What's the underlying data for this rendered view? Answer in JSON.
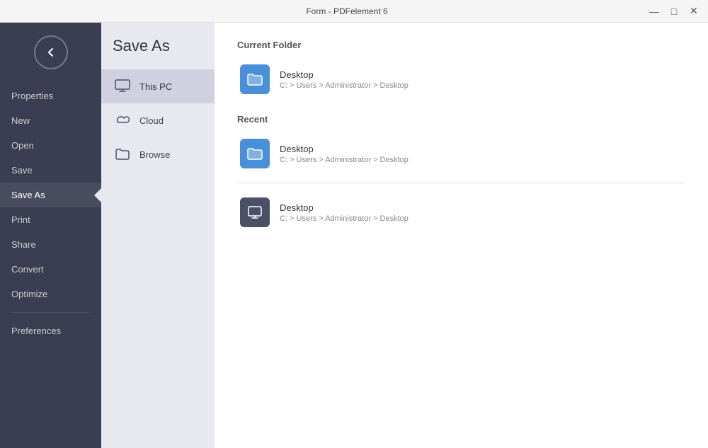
{
  "window": {
    "title": "Form - PDFelement 6",
    "controls": {
      "minimize": "—",
      "maximize": "□",
      "close": "✕"
    }
  },
  "sidebar": {
    "items": [
      {
        "id": "properties",
        "label": "Properties"
      },
      {
        "id": "new",
        "label": "New"
      },
      {
        "id": "open",
        "label": "Open"
      },
      {
        "id": "save",
        "label": "Save"
      },
      {
        "id": "save-as",
        "label": "Save As",
        "active": true
      },
      {
        "id": "print",
        "label": "Print"
      },
      {
        "id": "share",
        "label": "Share"
      },
      {
        "id": "convert",
        "label": "Convert"
      },
      {
        "id": "optimize",
        "label": "Optimize"
      },
      {
        "id": "preferences",
        "label": "Preferences"
      }
    ]
  },
  "panel": {
    "title": "Save As",
    "locations": [
      {
        "id": "this-pc",
        "label": "This PC",
        "active": true
      },
      {
        "id": "cloud",
        "label": "Cloud"
      },
      {
        "id": "browse",
        "label": "Browse"
      }
    ]
  },
  "main": {
    "current_folder_label": "Current Folder",
    "recent_label": "Recent",
    "current_folder": {
      "name": "Desktop",
      "path": "C: > Users > Administrator > Desktop"
    },
    "recent_items": [
      {
        "name": "Desktop",
        "path": "C: > Users > Administrator > Desktop",
        "icon_style": "blue"
      },
      {
        "name": "Desktop",
        "path": "C: > Users > Administrator > Desktop",
        "icon_style": "dark"
      }
    ]
  }
}
